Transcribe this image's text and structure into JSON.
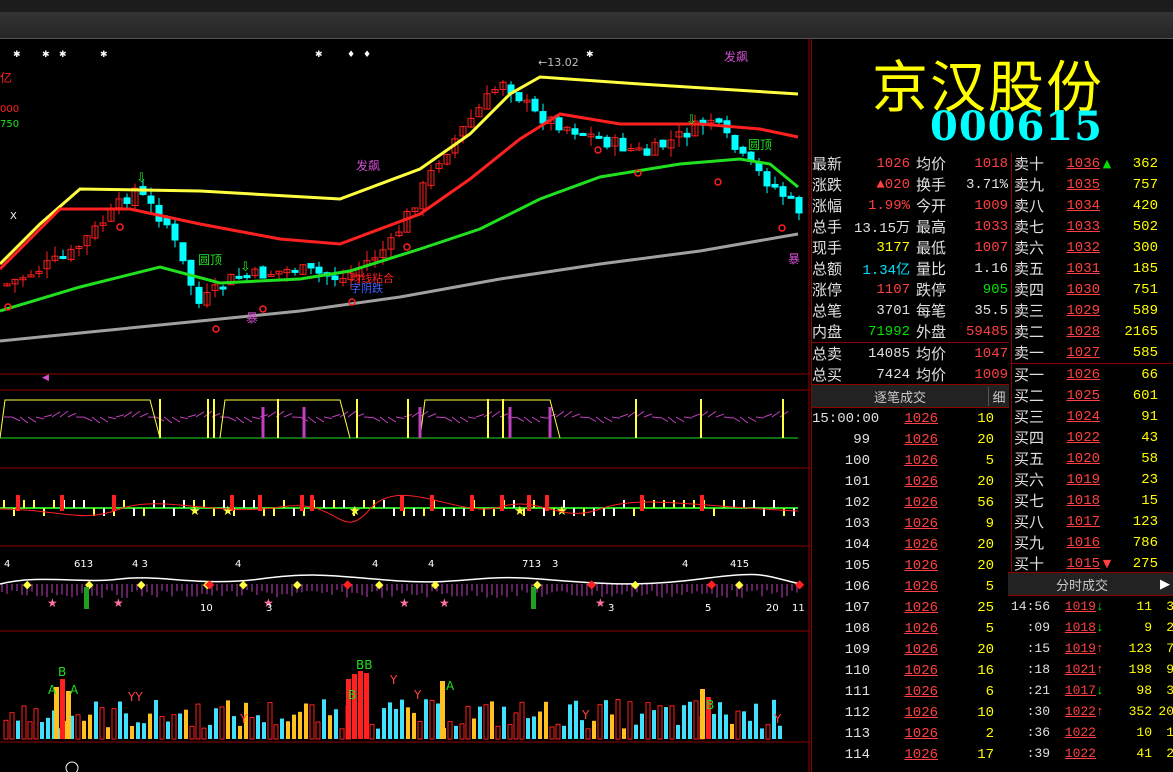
{
  "stock": {
    "name": "京汉股份",
    "code": "000615"
  },
  "quote": [
    {
      "l1": "最新",
      "v1": "1026",
      "c1": "red",
      "l2": "均价",
      "v2": "1018",
      "c2": "red"
    },
    {
      "l1": "涨跌",
      "v1": "▲020",
      "c1": "red",
      "l2": "换手",
      "v2": "3.71%",
      "c2": "white"
    },
    {
      "l1": "涨幅",
      "v1": "1.99%",
      "c1": "red",
      "l2": "今开",
      "v2": "1009",
      "c2": "red"
    },
    {
      "l1": "总手",
      "v1": "13.15万",
      "c1": "white",
      "l2": "最高",
      "v2": "1033",
      "c2": "red"
    },
    {
      "l1": "现手",
      "v1": "3177",
      "c1": "yel",
      "l2": "最低",
      "v2": "1007",
      "c2": "red"
    },
    {
      "l1": "总额",
      "v1": "1.34亿",
      "c1": "cyan",
      "l2": "量比",
      "v2": "1.16",
      "c2": "white"
    },
    {
      "l1": "涨停",
      "v1": "1107",
      "c1": "red",
      "l2": "跌停",
      "v2": "905",
      "c2": "green"
    },
    {
      "l1": "总笔",
      "v1": "3701",
      "c1": "white",
      "l2": "每笔",
      "v2": "35.5",
      "c2": "white"
    },
    {
      "l1": "内盘",
      "v1": "71992",
      "c1": "green",
      "l2": "外盘",
      "v2": "59485",
      "c2": "red"
    },
    {
      "l1": "总卖",
      "v1": "14085",
      "c1": "white",
      "l2": "均价",
      "v2": "1047",
      "c2": "red"
    },
    {
      "l1": "总买",
      "v1": "7424",
      "c1": "white",
      "l2": "均价",
      "v2": "1009",
      "c2": "red"
    }
  ],
  "asks": [
    {
      "label": "卖十",
      "price": "1036",
      "arrow": "▲",
      "vol": "362"
    },
    {
      "label": "卖九",
      "price": "1035",
      "arrow": "",
      "vol": "757"
    },
    {
      "label": "卖八",
      "price": "1034",
      "arrow": "",
      "vol": "420"
    },
    {
      "label": "卖七",
      "price": "1033",
      "arrow": "",
      "vol": "502"
    },
    {
      "label": "卖六",
      "price": "1032",
      "arrow": "",
      "vol": "300"
    },
    {
      "label": "卖五",
      "price": "1031",
      "arrow": "",
      "vol": "185"
    },
    {
      "label": "卖四",
      "price": "1030",
      "arrow": "",
      "vol": "751"
    },
    {
      "label": "卖三",
      "price": "1029",
      "arrow": "",
      "vol": "589"
    },
    {
      "label": "卖二",
      "price": "1028",
      "arrow": "",
      "vol": "2165"
    },
    {
      "label": "卖一",
      "price": "1027",
      "arrow": "",
      "vol": "585"
    }
  ],
  "bids": [
    {
      "label": "买一",
      "price": "1026",
      "arrow": "",
      "vol": "66"
    },
    {
      "label": "买二",
      "price": "1025",
      "arrow": "",
      "vol": "601"
    },
    {
      "label": "买三",
      "price": "1024",
      "arrow": "",
      "vol": "91"
    },
    {
      "label": "买四",
      "price": "1022",
      "arrow": "",
      "vol": "43"
    },
    {
      "label": "买五",
      "price": "1020",
      "arrow": "",
      "vol": "58"
    },
    {
      "label": "买六",
      "price": "1019",
      "arrow": "",
      "vol": "23"
    },
    {
      "label": "买七",
      "price": "1018",
      "arrow": "",
      "vol": "15"
    },
    {
      "label": "买八",
      "price": "1017",
      "arrow": "",
      "vol": "123"
    },
    {
      "label": "买九",
      "price": "1016",
      "arrow": "",
      "vol": "786"
    },
    {
      "label": "买十",
      "price": "1015",
      "arrow": "▼",
      "vol": "275"
    }
  ],
  "tick_panel": {
    "title": "逐笔成交",
    "detail": "细"
  },
  "ticks": [
    {
      "t": "15:00:00",
      "p": "1026",
      "v": "10"
    },
    {
      "t": "99",
      "p": "1026",
      "v": "20"
    },
    {
      "t": "100",
      "p": "1026",
      "v": "5"
    },
    {
      "t": "101",
      "p": "1026",
      "v": "20"
    },
    {
      "t": "102",
      "p": "1026",
      "v": "56"
    },
    {
      "t": "103",
      "p": "1026",
      "v": "9"
    },
    {
      "t": "104",
      "p": "1026",
      "v": "20"
    },
    {
      "t": "105",
      "p": "1026",
      "v": "20"
    },
    {
      "t": "106",
      "p": "1026",
      "v": "5"
    },
    {
      "t": "107",
      "p": "1026",
      "v": "25"
    },
    {
      "t": "108",
      "p": "1026",
      "v": "5"
    },
    {
      "t": "109",
      "p": "1026",
      "v": "20"
    },
    {
      "t": "110",
      "p": "1026",
      "v": "16"
    },
    {
      "t": "111",
      "p": "1026",
      "v": "6"
    },
    {
      "t": "112",
      "p": "1026",
      "v": "10"
    },
    {
      "t": "113",
      "p": "1026",
      "v": "2"
    },
    {
      "t": "114",
      "p": "1026",
      "v": "17"
    }
  ],
  "minute_panel": {
    "title": "分时成交",
    "next": "▶"
  },
  "minutes": [
    {
      "t": "14:56",
      "p": "1019",
      "dir": "dn",
      "v": "11",
      "x": "3"
    },
    {
      "t": ":09",
      "p": "1018",
      "dir": "dn",
      "v": "9",
      "x": "2"
    },
    {
      "t": ":15",
      "p": "1019",
      "dir": "up",
      "v": "123",
      "x": "7"
    },
    {
      "t": ":18",
      "p": "1021",
      "dir": "up",
      "v": "198",
      "x": "9"
    },
    {
      "t": ":21",
      "p": "1017",
      "dir": "dn",
      "v": "98",
      "x": "3"
    },
    {
      "t": ":30",
      "p": "1022",
      "dir": "up",
      "v": "352",
      "x": "20"
    },
    {
      "t": ":36",
      "p": "1022",
      "dir": "",
      "v": "10",
      "x": "1"
    },
    {
      "t": ":39",
      "p": "1022",
      "dir": "",
      "v": "41",
      "x": "2"
    }
  ],
  "chart_labels": {
    "left_axis_unit": "亿",
    "left_axis_vals": [
      "000",
      "750"
    ],
    "peak_price": "13.02",
    "signal_fapiao": "发飙",
    "signal_yuanding": "圆顶",
    "signal_baodie": "暴",
    "signal_junxian": "均线粘合",
    "signal_yinxian": "字阴跌",
    "signal_x": "X"
  },
  "colors": {
    "up": "#ff2020",
    "down": "#00ffff",
    "ma5": "#ffff40",
    "ma10": "#ff2020",
    "ma20": "#20e020",
    "ma60": "#a0a0a0",
    "grid": "#8b0000"
  }
}
